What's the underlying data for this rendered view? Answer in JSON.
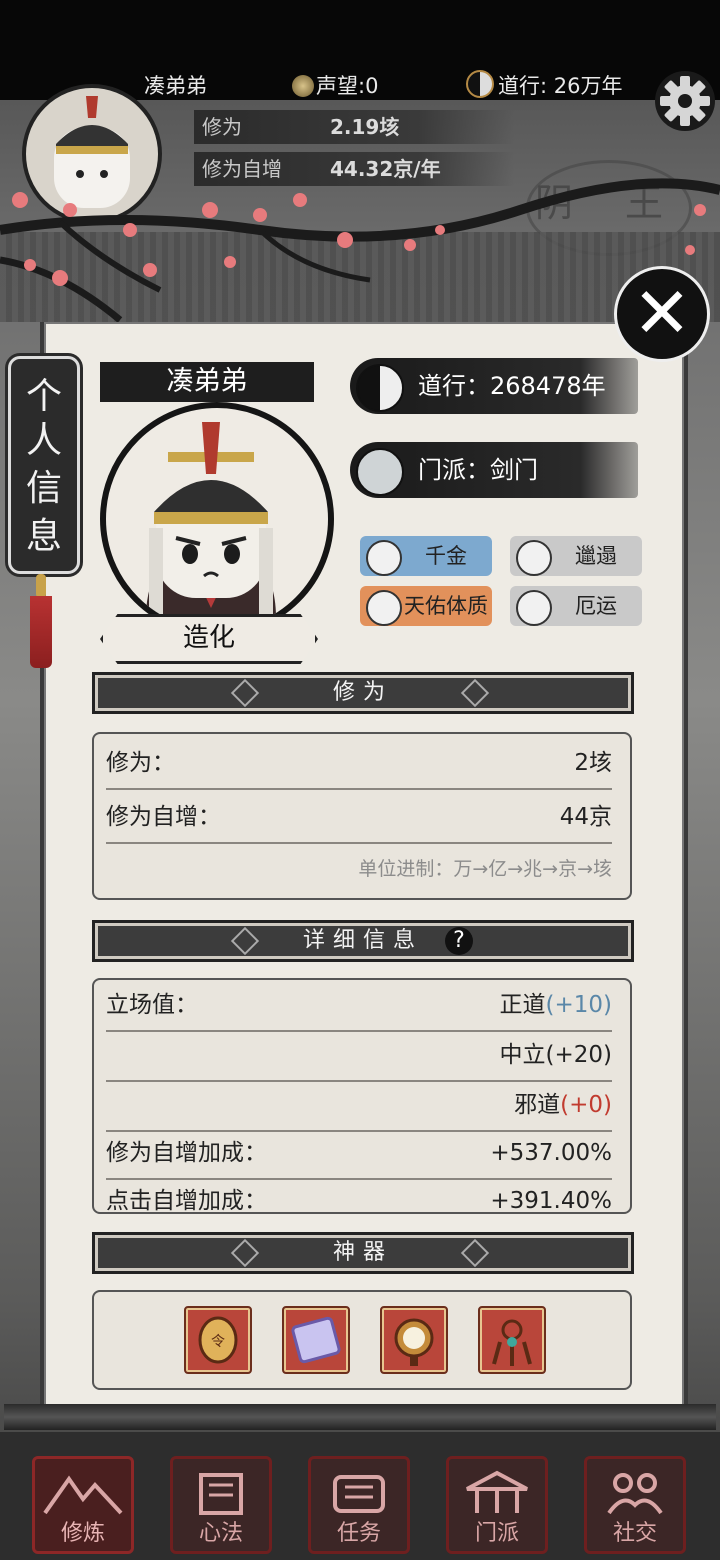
{
  "header": {
    "player_name": "凑弟弟",
    "reputation": "声望:0",
    "daoxing": "道行: 26万年",
    "stats": [
      {
        "label": "修为",
        "value": "2.19垓"
      },
      {
        "label": "修为自增",
        "value": "44.32京/年"
      }
    ],
    "stamp_text": "阴 王"
  },
  "panel": {
    "side_tab": [
      "个",
      "人",
      "信",
      "息"
    ],
    "name": "凑弟弟",
    "rank": "造化",
    "daoxing": "道行：268478年",
    "sect": "门派：剑门",
    "traits": [
      {
        "label": "千金",
        "color": "#7da9cf"
      },
      {
        "label": "邋遢",
        "color": "#c9c9c9"
      },
      {
        "label": "天佑体质",
        "color": "#e2915b"
      },
      {
        "label": "厄运",
        "color": "#c9c9c9"
      }
    ],
    "cultivation": {
      "title": "修为",
      "rows": [
        {
          "label": "修为：",
          "value": "2垓"
        },
        {
          "label": "修为自增：",
          "value": "44京"
        }
      ],
      "note": "单位进制：万→亿→兆→京→垓"
    },
    "details": {
      "title": "详细信息",
      "help": "?",
      "stance_label": "立场值：",
      "stance": [
        {
          "name": "正道",
          "bonus": "(+10)"
        },
        {
          "name": "中立",
          "bonus": "(+20)"
        },
        {
          "name": "邪道",
          "bonus": "(+0)"
        }
      ],
      "growth_label": "修为自增加成：",
      "growth_value": "+537.00%",
      "partial_label": "点击自增加成：",
      "partial_value": "+391.40%"
    },
    "artifacts": {
      "title": "神器",
      "items": [
        "token-icon",
        "scroll-icon",
        "mirror-icon",
        "ornament-icon"
      ]
    }
  },
  "nav": [
    {
      "label": "修炼",
      "icon": "mountain-icon"
    },
    {
      "label": "心法",
      "icon": "book-icon"
    },
    {
      "label": "任务",
      "icon": "scroll-icon"
    },
    {
      "label": "门派",
      "icon": "pavilion-icon"
    },
    {
      "label": "社交",
      "icon": "people-icon"
    }
  ]
}
